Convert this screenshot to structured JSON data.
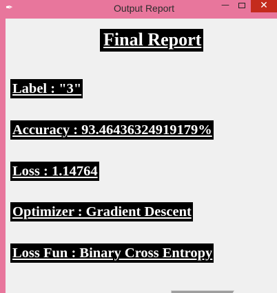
{
  "window": {
    "title": "Output Report",
    "controls": {
      "minimize": "—",
      "close": "✕"
    }
  },
  "report": {
    "heading": "Final Report",
    "label": "Label : \"3\"",
    "accuracy": "Accuracy : 93.46436324919179%",
    "loss": "Loss : 1.14764",
    "optimizer": "Optimizer : Gradient Descent",
    "loss_fun": "Loss Fun : Binary Cross Entropy"
  },
  "colors": {
    "titlebar": "#e8769c",
    "client_background": "#f0f0f0",
    "label_background": "#000000",
    "label_text": "#ffffff",
    "close_button": "#c42b1c"
  },
  "icons": [
    "feather-icon",
    "minimize-icon",
    "maximize-icon",
    "close-icon"
  ]
}
